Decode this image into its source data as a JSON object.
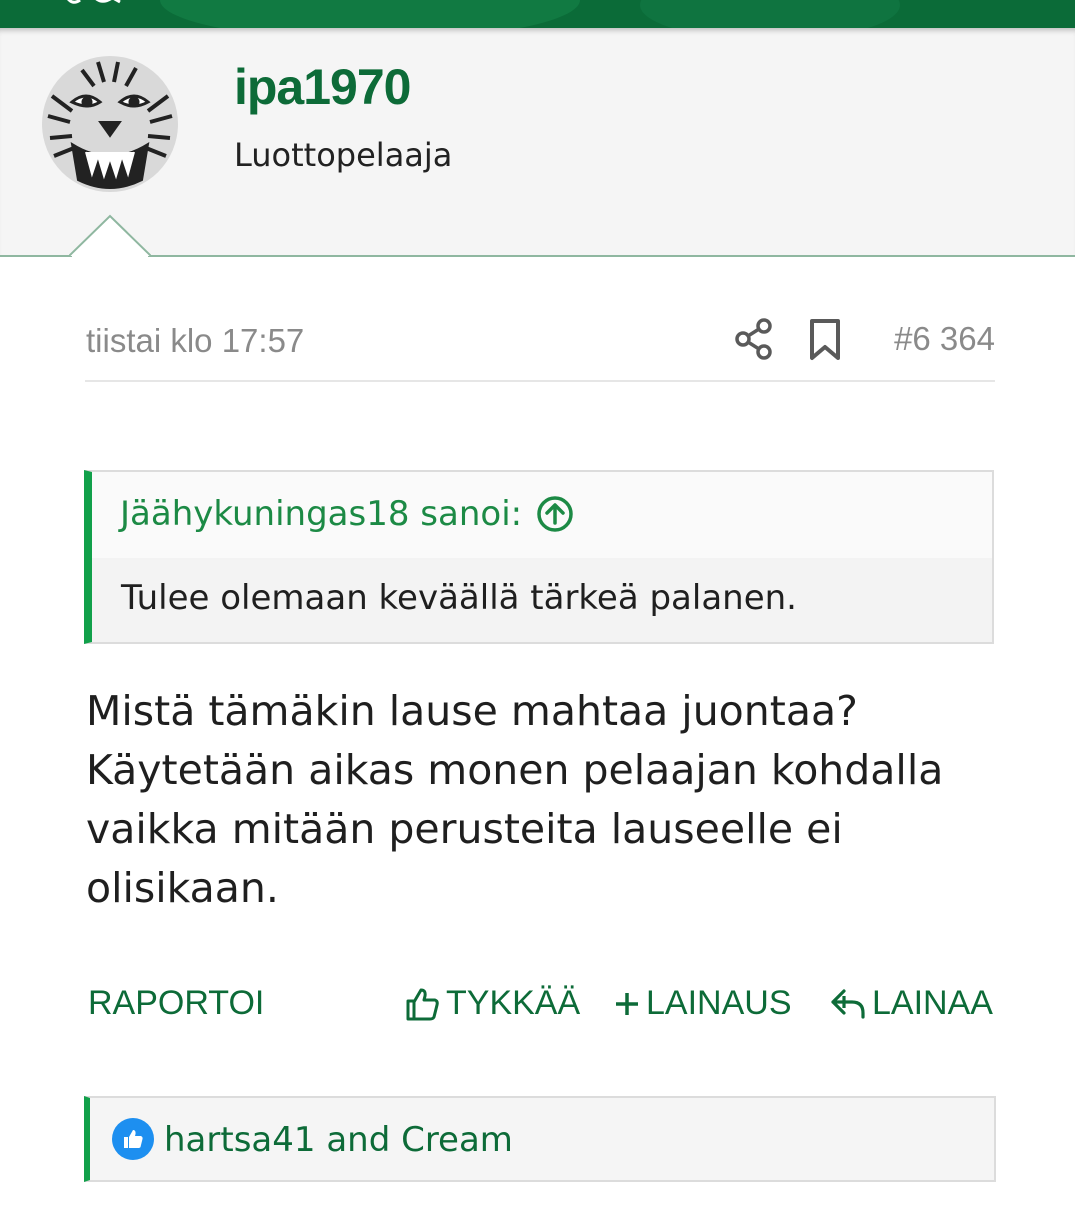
{
  "theme": {
    "accent": "#0d6b38",
    "quote_bar": "#11a04a",
    "muted": "#8a8a8a"
  },
  "user": {
    "name": "ipa1970",
    "title": "Luottopelaaja",
    "avatar_icon": "tiger-avatar-icon"
  },
  "post": {
    "time": "tiistai klo 17:57",
    "number": "#6 364",
    "icons": [
      "share-icon",
      "bookmark-icon"
    ],
    "quote": {
      "author": "Jäähykuningas18 sanoi:",
      "text": "Tulee olemaan keväällä tärkeä palanen."
    },
    "message": "Mistä tämäkin lause mahtaa juontaa? Käytetään aikas monen pelaajan kohdalla vaikka mitään perusteita lauseelle ei olisikaan."
  },
  "actions": {
    "report": "RAPORTOI",
    "like": "TYKKÄÄ",
    "multiquote": "LAINAUS",
    "reply": "LAINAA"
  },
  "reactions": {
    "text": "hartsa41 and Cream"
  }
}
